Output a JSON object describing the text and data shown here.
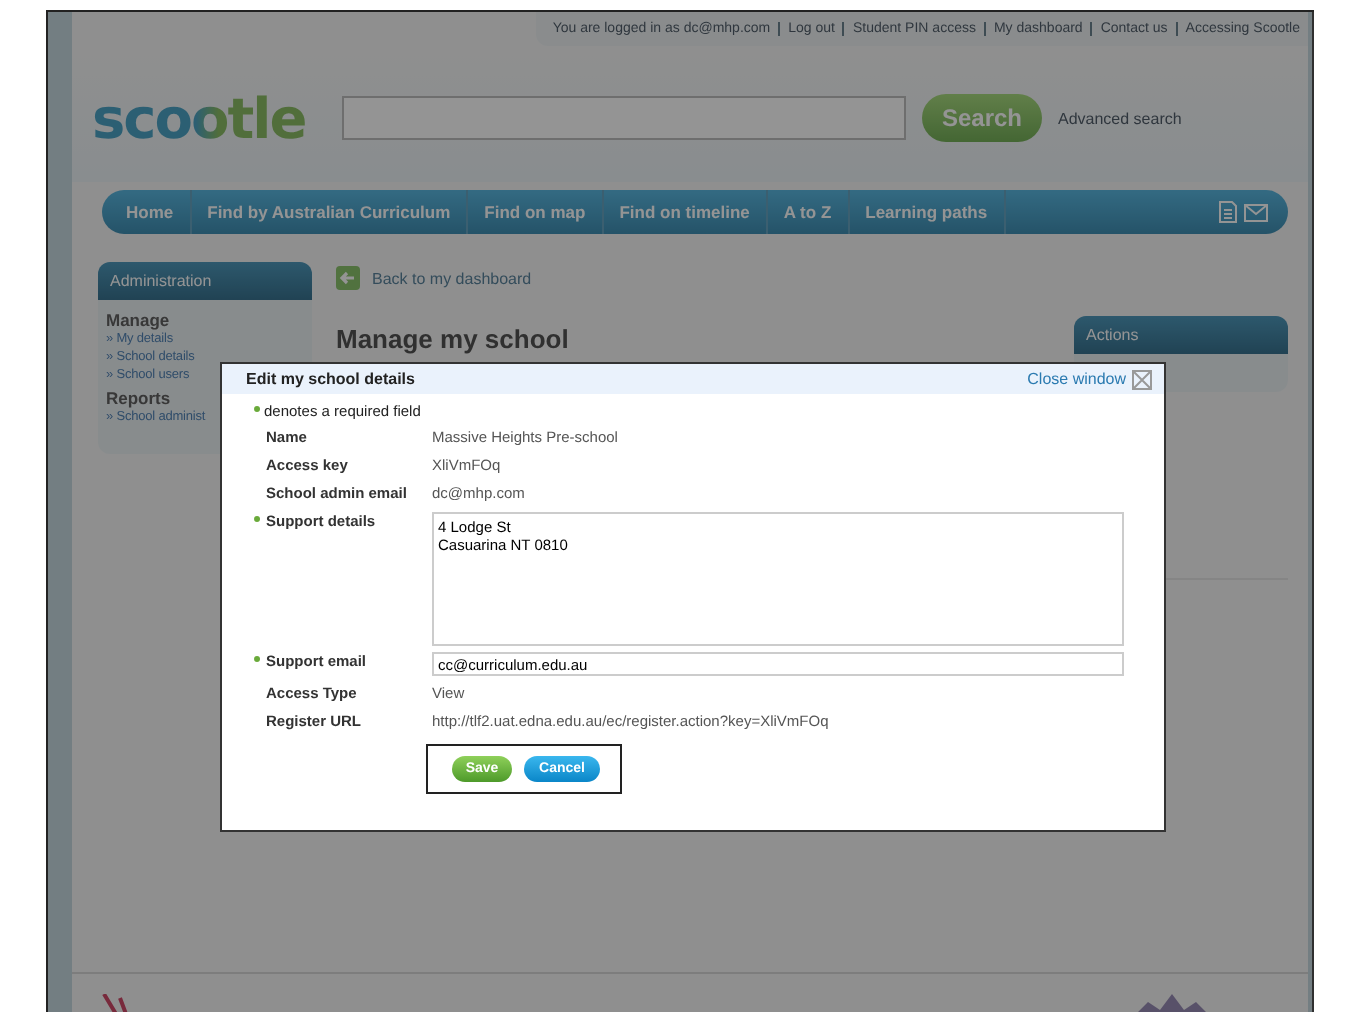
{
  "top_links": [
    "You are logged in as dc@mhp.com",
    "Log out",
    "Student PIN access",
    "My dashboard",
    "Contact us",
    "Accessing Scootle"
  ],
  "logo": "scootle",
  "search": {
    "button": "Search",
    "advanced": "Advanced search"
  },
  "nav": [
    "Home",
    "Find by Australian Curriculum",
    "Find on map",
    "Find on timeline",
    "A to Z",
    "Learning paths"
  ],
  "sidebar": {
    "title": "Administration",
    "sections": [
      {
        "heading": "Manage",
        "items": [
          "» My details",
          "» School details",
          "» School users"
        ]
      },
      {
        "heading": "Reports",
        "items": [
          "» School administ"
        ]
      }
    ]
  },
  "back_link": "Back to my dashboard",
  "heading": "Manage my school",
  "actions": {
    "title": "Actions"
  },
  "modal": {
    "title": "Edit my school details",
    "close": "Close window",
    "required_note": "denotes a required field",
    "fields": [
      {
        "kind": "text",
        "label": "Name",
        "value": "Massive Heights Pre-school",
        "required": false
      },
      {
        "kind": "text",
        "label": "Access key",
        "value": "XliVmFOq",
        "required": false
      },
      {
        "kind": "text",
        "label": "School admin email",
        "value": "dc@mhp.com",
        "required": false
      },
      {
        "kind": "textarea",
        "label": "Support details",
        "value": "4 Lodge St\nCasuarina NT 0810",
        "required": true
      },
      {
        "kind": "input",
        "label": "Support email",
        "value": "cc@curriculum.edu.au",
        "required": true
      },
      {
        "kind": "text",
        "label": "Access Type",
        "value": "View",
        "required": false
      },
      {
        "kind": "text",
        "label": "Register URL",
        "value": "http://tlf2.uat.edna.edu.au/ec/register.action?key=XliVmFOq",
        "required": false
      }
    ],
    "buttons": [
      {
        "kind": "save",
        "label": "Save"
      },
      {
        "kind": "cancel",
        "label": "Cancel"
      }
    ]
  }
}
